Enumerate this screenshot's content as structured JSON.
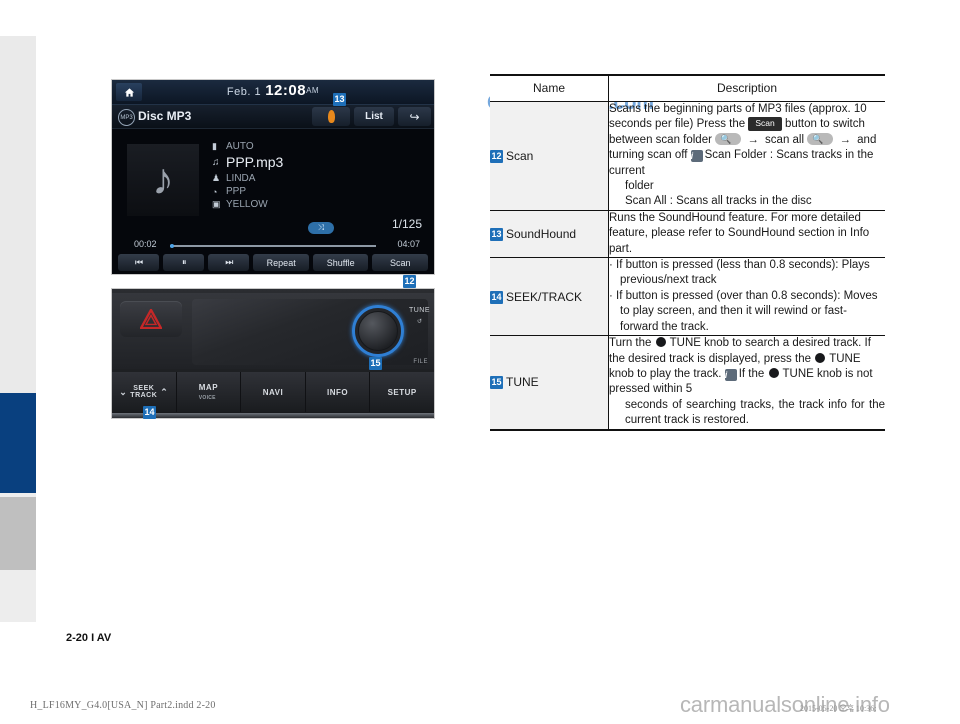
{
  "page": {
    "label": "2-20 I AV",
    "file_meta": "H_LF16MY_G4.0[USA_N] Part2.indd   2-20",
    "time_meta": "2015-05-20   오후 10:36:",
    "watermark_top": "CarManuals2.com",
    "watermark_bottom": "carmanualsonline.info",
    "accent_blue": "#1e6fb8",
    "band_blue": "#09407f",
    "band_gray": "#bfbfbf"
  },
  "head_unit": {
    "home_icon": "home-icon",
    "date": "Feb.  1",
    "time": "12:08",
    "ampm": "AM",
    "source_icon": "mp3-disc-icon",
    "source_label": "Disc MP3",
    "soundhound_icon": "soundhound-icon",
    "list_label": "List",
    "back_icon": "back-arrow-icon",
    "album_art_icon": "music-note-icon",
    "meta": [
      {
        "icon": "folder-icon",
        "glyph": "▮",
        "text": "AUTO"
      },
      {
        "icon": "note-icon",
        "glyph": "♫",
        "text": "PPP.mp3"
      },
      {
        "icon": "artist-icon",
        "glyph": "♟",
        "text": "LINDA"
      },
      {
        "icon": "album-icon",
        "glyph": "◔",
        "text": "PPP"
      },
      {
        "icon": "genre-icon",
        "glyph": "▣",
        "text": "YELLOW"
      }
    ],
    "shuffle_indicator": "⤨",
    "track_no": "1/125",
    "time_current": "00:02",
    "time_total": "04:07",
    "controls": [
      {
        "name": "previous-track-button",
        "label": "⏮"
      },
      {
        "name": "pause-button",
        "label": "⏸"
      },
      {
        "name": "next-track-button",
        "label": "⏭"
      },
      {
        "name": "repeat-button",
        "label": "Repeat"
      },
      {
        "name": "shuffle-button",
        "label": "Shuffle"
      },
      {
        "name": "scan-button",
        "label": "Scan"
      }
    ]
  },
  "console": {
    "hazard_icon": "hazard-triangle-icon",
    "tune_label": "TUNE",
    "file_label": "FILE",
    "arrow_glyph": "↺",
    "buttons": [
      {
        "name": "seek-track-button",
        "label": "SEEK",
        "sub": "TRACK"
      },
      {
        "name": "map-button",
        "label": "MAP",
        "sub": "VOICE"
      },
      {
        "name": "navi-button",
        "label": "NAVI",
        "sub": ""
      },
      {
        "name": "info-button",
        "label": "INFO",
        "sub": ""
      },
      {
        "name": "setup-button",
        "label": "SETUP",
        "sub": ""
      }
    ]
  },
  "callouts": {
    "c12": "12",
    "c13": "13",
    "c14": "14",
    "c15": "15"
  },
  "table": {
    "headers": {
      "name": "Name",
      "description": "Description"
    },
    "rows": [
      {
        "num": "12",
        "name": "Scan",
        "desc_lines": [
          "Scans the beginning parts of MP3 files (approx. 10 seconds per file)"
        ],
        "press_prefix": "Press the",
        "chip": "Scan",
        "press_suffix": "button to switch between scan folder",
        "folder_pill_icon": "scan-folder-icon",
        "arrow1": "→",
        "mid_text": "scan all",
        "all_pill_icon": "scan-all-icon",
        "arrow2": "→",
        "tail_text": "and turning scan off",
        "info_badge": "i",
        "info_line1": "Scan Folder : Scans tracks in the current",
        "info_line1b": "folder",
        "info_line2": "Scan All : Scans all tracks in the disc"
      },
      {
        "num": "13",
        "name": "SoundHound",
        "desc_lines": [
          "Runs the SoundHound feature.",
          "For more detailed feature, please refer to SoundHound section in Info part."
        ]
      },
      {
        "num": "14",
        "name": "SEEK/TRACK",
        "bullets": [
          "If button is pressed (less than 0.8 seconds): Plays previous/next track",
          "If button is pressed (over than 0.8 seconds): Moves to play screen, and then it will rewind or fast-forward the track."
        ]
      },
      {
        "num": "15",
        "name": "TUNE",
        "tune_p1a": "Turn the",
        "tune_p1b": "TUNE knob to search a desired track. If the desired track is displayed, press the",
        "tune_p1c": "TUNE knob to play the track.",
        "info_badge": "i",
        "tune_p2a": "If the",
        "tune_p2b": "TUNE knob is not pressed within 5",
        "tune_p2c": "seconds of searching tracks, the track info for the current track is restored."
      }
    ]
  }
}
